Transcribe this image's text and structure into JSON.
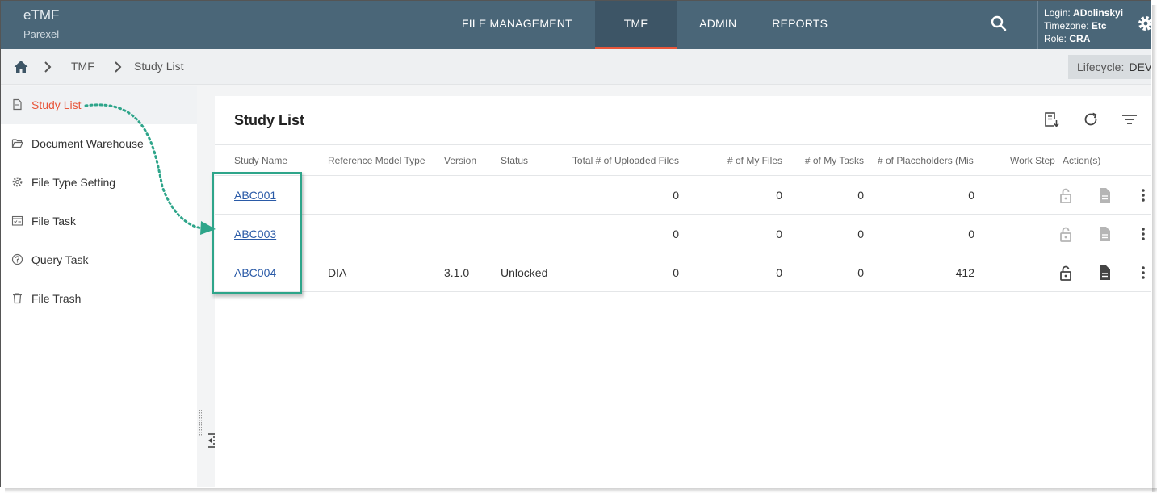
{
  "header": {
    "app_name": "eTMF",
    "org_name": "Parexel",
    "nav": [
      {
        "label": "FILE MANAGEMENT",
        "active": false
      },
      {
        "label": "TMF",
        "active": true
      },
      {
        "label": "ADMIN",
        "active": false
      },
      {
        "label": "REPORTS",
        "active": false
      }
    ],
    "user": {
      "login_label": "Login:",
      "login_value": "ADolinskyi",
      "timezone_label": "Timezone:",
      "timezone_value": "Etc",
      "role_label": "Role:",
      "role_value": "CRA"
    }
  },
  "breadcrumb": {
    "items": [
      "TMF",
      "Study List"
    ]
  },
  "lifecycle": {
    "label": "Lifecycle:",
    "value": "DEV"
  },
  "sidebar": {
    "items": [
      {
        "label": "Study List",
        "icon": "document-icon",
        "active": true
      },
      {
        "label": "Document Warehouse",
        "icon": "folder-open-icon",
        "active": false
      },
      {
        "label": "File Type Setting",
        "icon": "gear-icon",
        "active": false
      },
      {
        "label": "File Task",
        "icon": "task-list-icon",
        "active": false
      },
      {
        "label": "Query Task",
        "icon": "help-circle-icon",
        "active": false
      },
      {
        "label": "File Trash",
        "icon": "trash-icon",
        "active": false
      }
    ]
  },
  "main": {
    "title": "Study List",
    "columns": [
      "Study Name",
      "Reference Model Type",
      "Version",
      "Status",
      "Total # of Uploaded Files",
      "# of My Files",
      "# of My Tasks",
      "# of Placeholders (Missing)",
      "Work Step",
      "Action(s)"
    ],
    "rows": [
      {
        "study_name": "ABC001",
        "reference_model_type": "",
        "version": "",
        "status": "",
        "total_uploaded": "0",
        "my_files": "0",
        "my_tasks": "0",
        "placeholders": "0",
        "work_step": "",
        "actions_enabled": false
      },
      {
        "study_name": "ABC003",
        "reference_model_type": "",
        "version": "",
        "status": "",
        "total_uploaded": "0",
        "my_files": "0",
        "my_tasks": "0",
        "placeholders": "0",
        "work_step": "",
        "actions_enabled": false
      },
      {
        "study_name": "ABC004",
        "reference_model_type": "DIA",
        "version": "3.1.0",
        "status": "Unlocked",
        "total_uploaded": "0",
        "my_files": "0",
        "my_tasks": "0",
        "placeholders": "412",
        "work_step": "",
        "actions_enabled": true
      }
    ]
  },
  "colors": {
    "header_bg": "#4a6678",
    "accent": "#e8563a",
    "link": "#2a5aa7",
    "highlight": "#2ea58a"
  }
}
